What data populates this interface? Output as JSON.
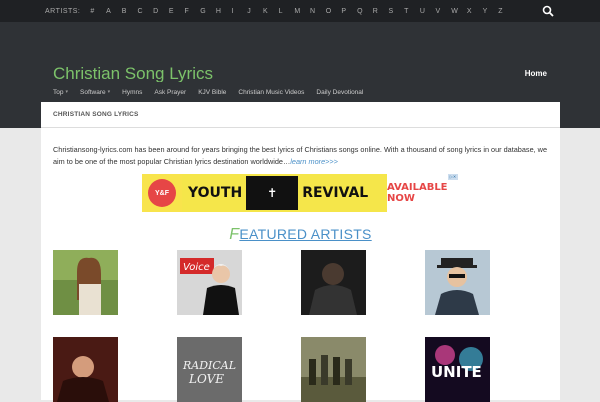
{
  "topbar": {
    "artists_label": "ARTISTS:",
    "letters": [
      "#",
      "A",
      "B",
      "C",
      "D",
      "E",
      "F",
      "G",
      "H",
      "I",
      "J",
      "K",
      "L",
      "M",
      "N",
      "O",
      "P",
      "Q",
      "R",
      "S",
      "T",
      "U",
      "V",
      "W",
      "X",
      "Y",
      "Z"
    ],
    "search_icon": "search-icon"
  },
  "header": {
    "site_title": "Christian Song Lyrics",
    "home_link": "Home"
  },
  "nav": {
    "items": [
      {
        "label": "Top",
        "dropdown": true
      },
      {
        "label": "Software",
        "dropdown": true
      },
      {
        "label": "Hymns",
        "dropdown": false
      },
      {
        "label": "Ask Prayer",
        "dropdown": false
      },
      {
        "label": "KJV Bible",
        "dropdown": false
      },
      {
        "label": "Christian Music Videos",
        "dropdown": false
      },
      {
        "label": "Daily Devotional",
        "dropdown": false
      }
    ]
  },
  "content": {
    "breadcrumb": "CHRISTIAN SONG LYRICS",
    "intro": "Christiansong-lyrics.com has been around for years bringing the best lyrics of Christians songs online. With a thousand of song lyrics in our database, we aim to be one of the most popular Christian lyrics destination worldwide…",
    "learn_more": "learn more>>>"
  },
  "ad": {
    "badge": "Y&F",
    "word1": "YOUTH",
    "word2": "REVIVAL",
    "cta": "AVAILABLE NOW"
  },
  "featured": {
    "first_letter": "F",
    "rest": "EATURED ARTISTS"
  },
  "colors": {
    "title_green": "#7cc26a",
    "link_blue": "#4a90c8",
    "header_bg": "#2f3236",
    "topbar_bg": "#1f2124"
  }
}
